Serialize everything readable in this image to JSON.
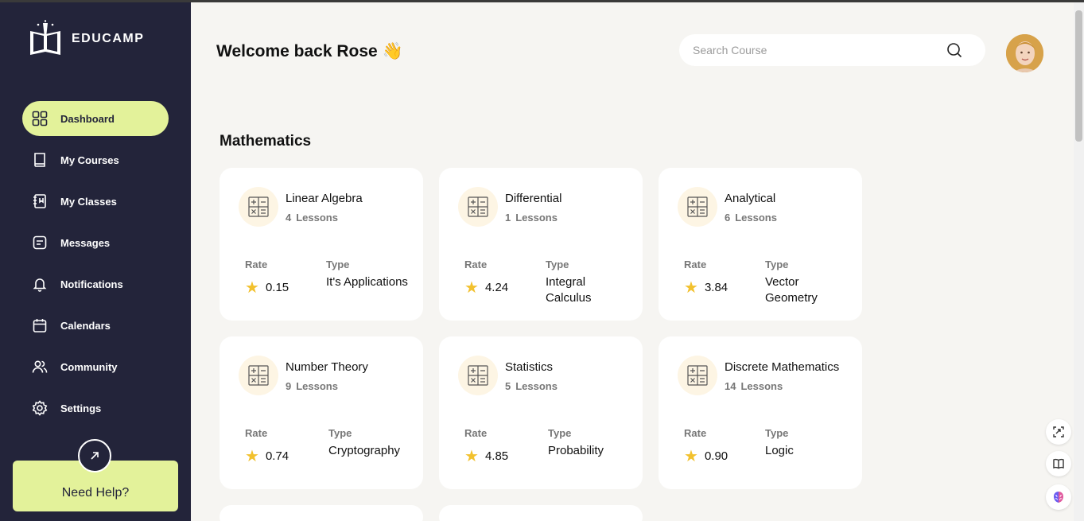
{
  "app": {
    "brand": "EDUCAMP"
  },
  "sidebar": {
    "items": [
      {
        "label": "Dashboard",
        "icon": "grid-icon",
        "active": true
      },
      {
        "label": "My Courses",
        "icon": "book-icon"
      },
      {
        "label": "My Classes",
        "icon": "notebook-icon"
      },
      {
        "label": "Messages",
        "icon": "message-icon"
      },
      {
        "label": "Notifications",
        "icon": "bell-icon"
      },
      {
        "label": "Calendars",
        "icon": "calendar-icon"
      },
      {
        "label": "Community",
        "icon": "users-icon"
      },
      {
        "label": "Settings",
        "icon": "gear-icon"
      }
    ],
    "help_label": "Need Help?"
  },
  "header": {
    "welcome": "Welcome back Rose 👋",
    "search_placeholder": "Search Course"
  },
  "main": {
    "section_title": "Mathematics",
    "rate_label": "Rate",
    "type_label": "Type",
    "courses": [
      {
        "title": "Linear Algebra",
        "lessons": "4",
        "lessons_label": "Lessons",
        "rate": "0.15",
        "type": "It's Applications"
      },
      {
        "title": "Differential",
        "lessons": "1",
        "lessons_label": "Lessons",
        "rate": "4.24",
        "type": "Integral Calculus"
      },
      {
        "title": "Analytical",
        "lessons": "6",
        "lessons_label": "Lessons",
        "rate": "3.84",
        "type": "Vector Geometry"
      },
      {
        "title": "Number Theory",
        "lessons": "9",
        "lessons_label": "Lessons",
        "rate": "0.74",
        "type": "Cryptography"
      },
      {
        "title": "Statistics",
        "lessons": "5",
        "lessons_label": "Lessons",
        "rate": "4.85",
        "type": "Probability"
      },
      {
        "title": "Discrete Mathematics",
        "lessons": "14",
        "lessons_label": "Lessons",
        "rate": "0.90",
        "type": "Logic"
      }
    ]
  },
  "colors": {
    "sidebar_bg": "#23243a",
    "accent": "#e3f29a",
    "star": "#f2c12e",
    "page_bg": "#f6f5f2"
  }
}
